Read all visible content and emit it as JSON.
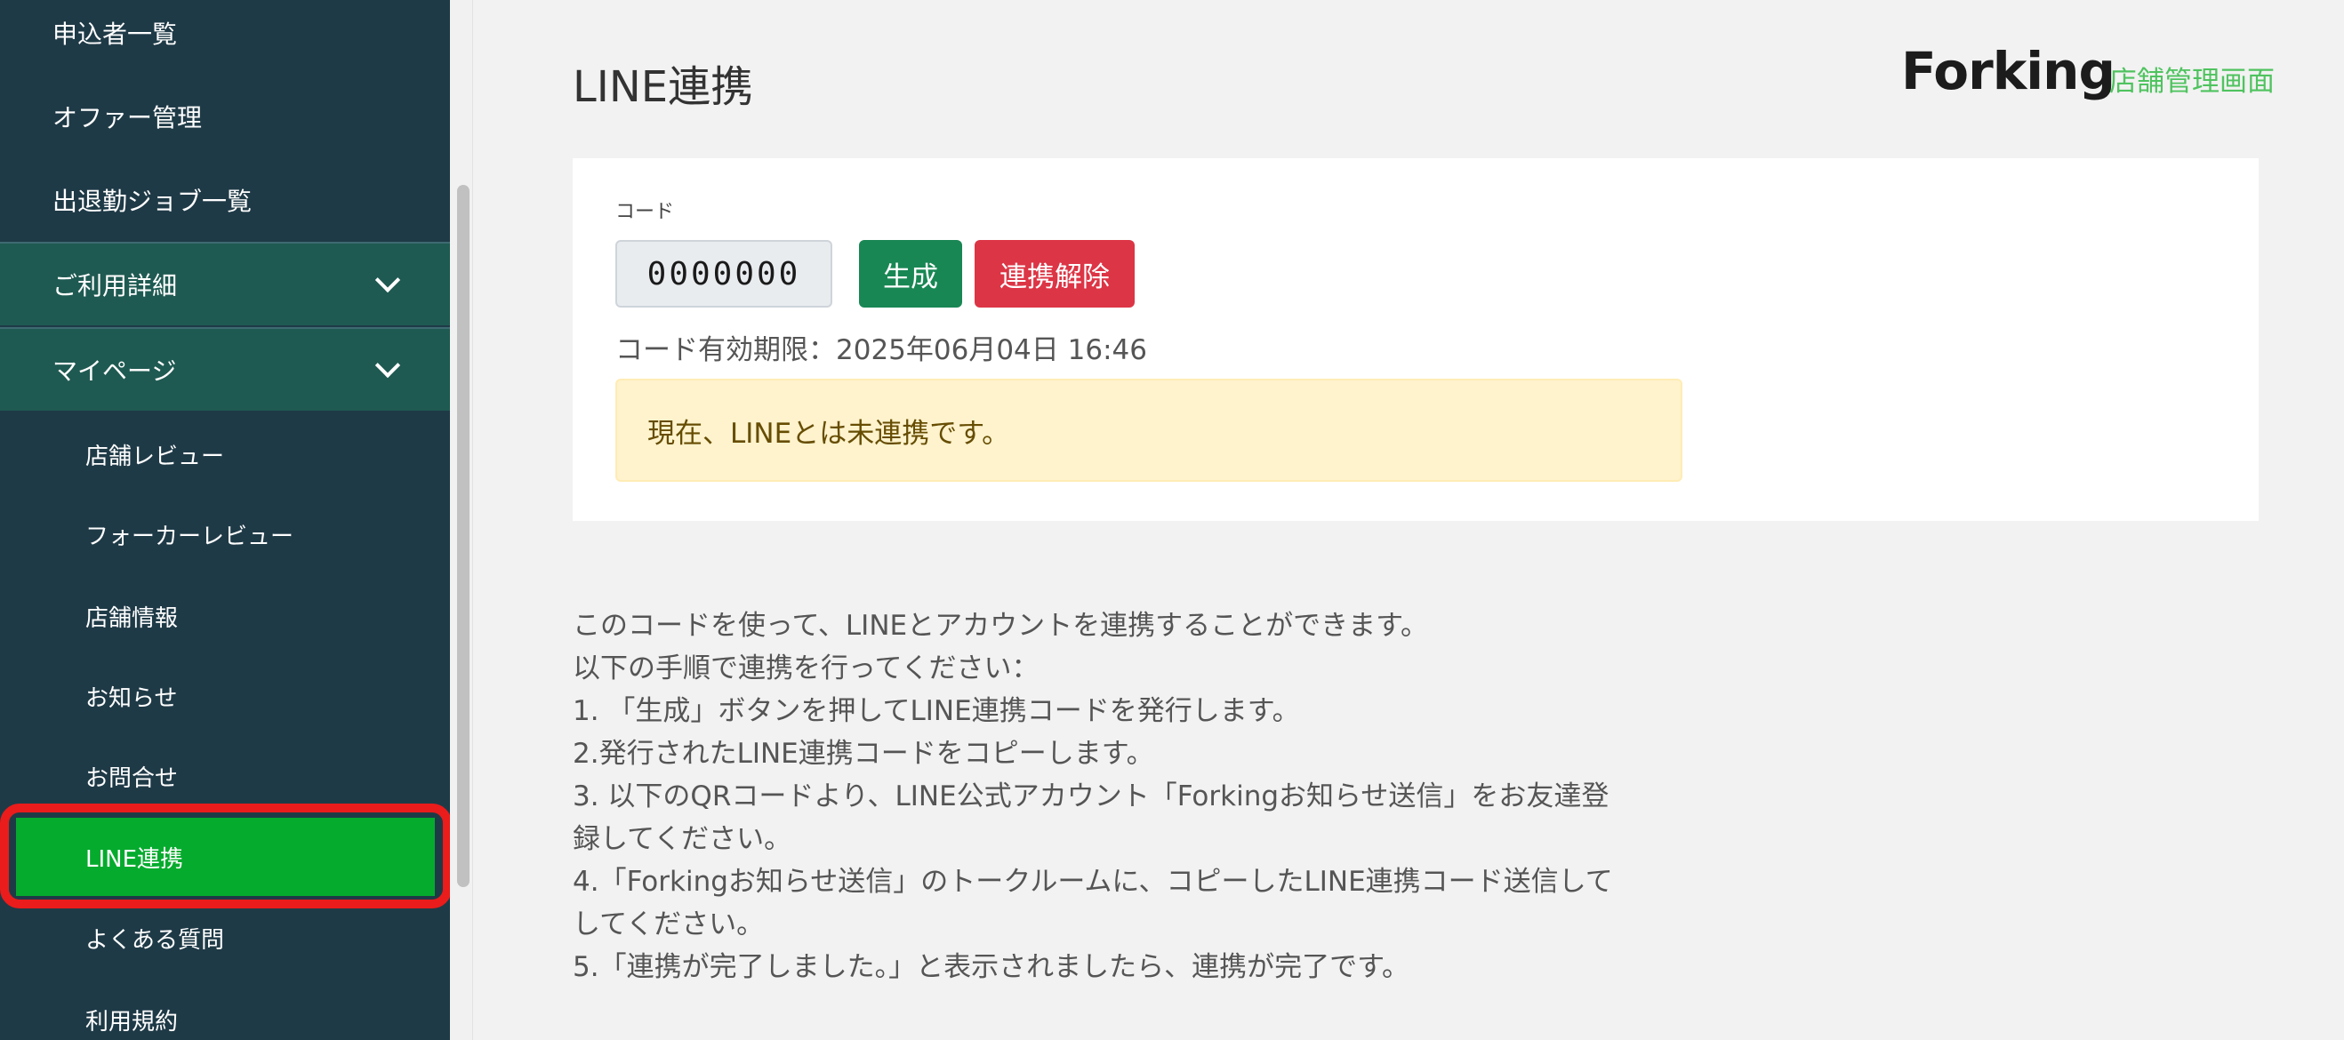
{
  "sidebar": {
    "items": [
      {
        "label": "申込者一覧"
      },
      {
        "label": "オファー管理"
      },
      {
        "label": "出退勤ジョブ一覧"
      }
    ],
    "sections": [
      {
        "label": "ご利用詳細"
      },
      {
        "label": "マイページ"
      }
    ],
    "sub_items": [
      {
        "label": "店舗レビュー"
      },
      {
        "label": "フォーカーレビュー"
      },
      {
        "label": "店舗情報"
      },
      {
        "label": "お知らせ"
      },
      {
        "label": "お問合せ"
      },
      {
        "label": "LINE連携"
      },
      {
        "label": "よくある質問"
      },
      {
        "label": "利用規約"
      }
    ],
    "active_item": "LINE連携"
  },
  "header": {
    "title": "LINE連携",
    "logo": "Forking",
    "logo_subtitle": "店舗管理画面"
  },
  "card": {
    "code_label": "コード",
    "code_value": "0000000",
    "generate_button": "生成",
    "unlink_button": "連携解除",
    "expiry": "コード有効期限：2025年06月04日 16:46",
    "alert": "現在、LINEとは未連携です。"
  },
  "instructions": {
    "lines": [
      "このコードを使って、LINEとアカウントを連携することができます。",
      "以下の手順で連携を行ってください：",
      "1. 「生成」ボタンを押してLINE連携コードを発行します。",
      "2.発行されたLINE連携コードをコピーします。",
      "3. 以下のQRコードより、LINE公式アカウント「Forkingお知らせ送信」をお友達登",
      "録してください。",
      "4.「Forkingお知らせ送信」のトークルームに、コピーしたLINE連携コード送信して",
      "してください。",
      "5.「連携が完了しました。」と表示されましたら、連携が完了です。"
    ]
  },
  "colors": {
    "sidebar_bg": "#1f3a47",
    "section_bg": "#1f5a52",
    "active_bg": "#05ab2d",
    "highlight_outline": "#ea1c1c",
    "generate_button": "#198754",
    "unlink_button": "#dc3545",
    "logo_subtitle": "#4fc35f"
  },
  "icons": {
    "section_toggle": "chevron-down-icon"
  }
}
